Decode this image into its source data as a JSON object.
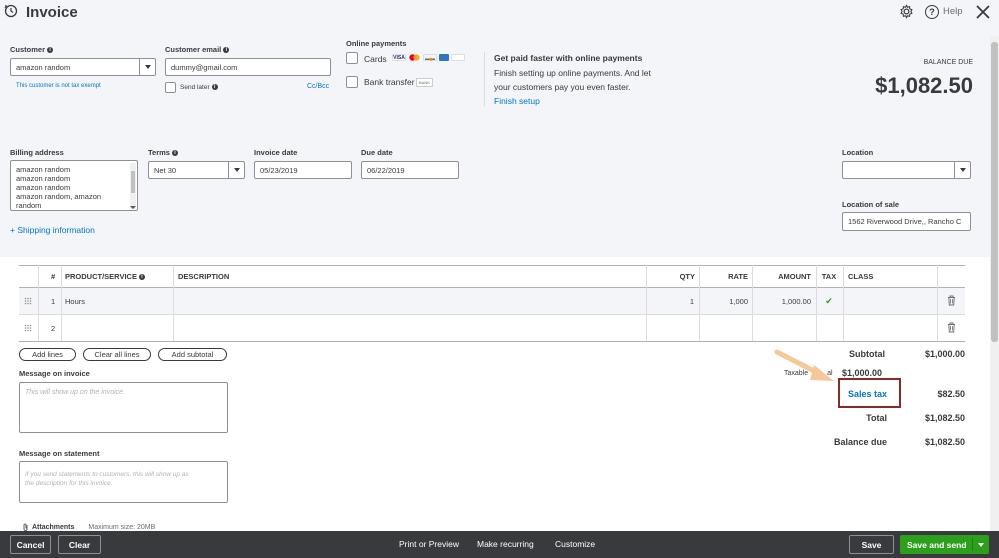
{
  "header": {
    "title": "Invoice",
    "help_label": "Help"
  },
  "customer": {
    "label": "Customer",
    "value": "amazon random",
    "tax_note": "This customer is not tax exempt"
  },
  "customer_email": {
    "label": "Customer email",
    "value": "dummy@gmail.com",
    "send_later_label": "Send later",
    "cc_bcc": "Cc/Bcc"
  },
  "online_payments": {
    "label": "Online payments",
    "cards_label": "Cards",
    "bank_label": "Bank transfer",
    "bank_badge": "BANK",
    "promo_title": "Get paid faster with online payments",
    "promo_text_1": "Finish setting up online payments. And let",
    "promo_text_2": "your customers pay you even faster.",
    "finish_setup": "Finish setup"
  },
  "balance": {
    "label": "BALANCE DUE",
    "value": "$1,082.50"
  },
  "billing": {
    "label": "Billing address",
    "lines": [
      "amazon random",
      "amazon random",
      "amazon random",
      "amazon random, amazon",
      "random"
    ]
  },
  "terms": {
    "label": "Terms",
    "value": "Net 30"
  },
  "invoice_date": {
    "label": "Invoice date",
    "value": "05/23/2019"
  },
  "due_date": {
    "label": "Due date",
    "value": "06/22/2019"
  },
  "location": {
    "label": "Location",
    "value": ""
  },
  "location_of_sale": {
    "label": "Location of sale",
    "value": "1562  Riverwood Drive,, Rancho C"
  },
  "shipping_link": "+ Shipping information",
  "table": {
    "headers": {
      "num": "#",
      "product": "PRODUCT/SERVICE",
      "description": "DESCRIPTION",
      "qty": "QTY",
      "rate": "RATE",
      "amount": "AMOUNT",
      "tax": "TAX",
      "class": "CLASS"
    },
    "rows": [
      {
        "num": "1",
        "product": "Hours",
        "description": "",
        "qty": "1",
        "rate": "1,000",
        "amount": "1,000.00",
        "tax": "✔",
        "class": ""
      },
      {
        "num": "2",
        "product": "",
        "description": "",
        "qty": "",
        "rate": "",
        "amount": "",
        "tax": "",
        "class": ""
      }
    ]
  },
  "table_buttons": {
    "add_lines": "Add lines",
    "clear_all": "Clear all lines",
    "add_subtotal": "Add subtotal"
  },
  "message_invoice": {
    "label": "Message on invoice",
    "placeholder": "This will show up on the invoice."
  },
  "message_statement": {
    "label": "Message on statement",
    "placeholder_1": "If you send statements to customers, this will show up as",
    "placeholder_2": "the description for this invoice."
  },
  "attachments": {
    "label": "Attachments",
    "max_size": "Maximum size: 20MB"
  },
  "totals": {
    "subtotal_label": "Subtotal",
    "subtotal_value": "$1,000.00",
    "taxable_label": "Taxable",
    "taxable_label_tail": "al",
    "taxable_value": "$1,000.00",
    "sales_tax_label": "Sales tax",
    "sales_tax_value": "$82.50",
    "total_label": "Total",
    "total_value": "$1,082.50",
    "balance_due_label": "Balance due",
    "balance_due_value": "$1,082.50"
  },
  "footer": {
    "cancel": "Cancel",
    "clear": "Clear",
    "print_preview": "Print or Preview",
    "make_recurring": "Make recurring",
    "customize": "Customize",
    "save": "Save",
    "save_and_send": "Save and send"
  },
  "colors": {
    "brand_green": "#2ca01c",
    "link_blue": "#0077c5",
    "footer_bg": "#393a3d",
    "highlight_box": "#8b2a2a",
    "arrow": "#f5c89a"
  }
}
